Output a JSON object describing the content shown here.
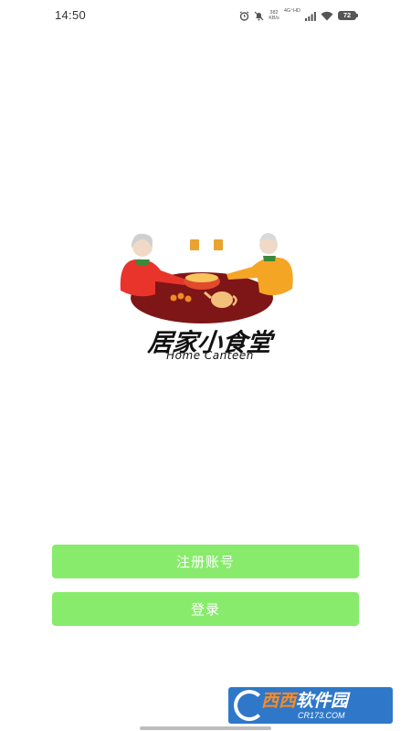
{
  "status_bar": {
    "time": "14:50",
    "net_speed_value": "382",
    "net_speed_unit": "KB/s",
    "net_type": "4G⁺HD",
    "battery_level": "72",
    "icons": [
      "alarm-icon",
      "mute-icon",
      "signal-icon",
      "wifi-icon",
      "battery-icon"
    ]
  },
  "logo": {
    "title": "居家小食堂",
    "subtitle": "Home Canteen",
    "colors": {
      "table": "#7e1516",
      "left_person": "#e8342a",
      "right_person": "#f5a524",
      "bowl": "#e14a2d"
    }
  },
  "actions": {
    "register_label": "注册账号",
    "login_label": "登录",
    "button_color": "#88eb6c"
  },
  "watermark": {
    "name_part1": "西西",
    "name_part2": "软件园",
    "url": "CR173.COM",
    "background": "#2f78c9"
  }
}
